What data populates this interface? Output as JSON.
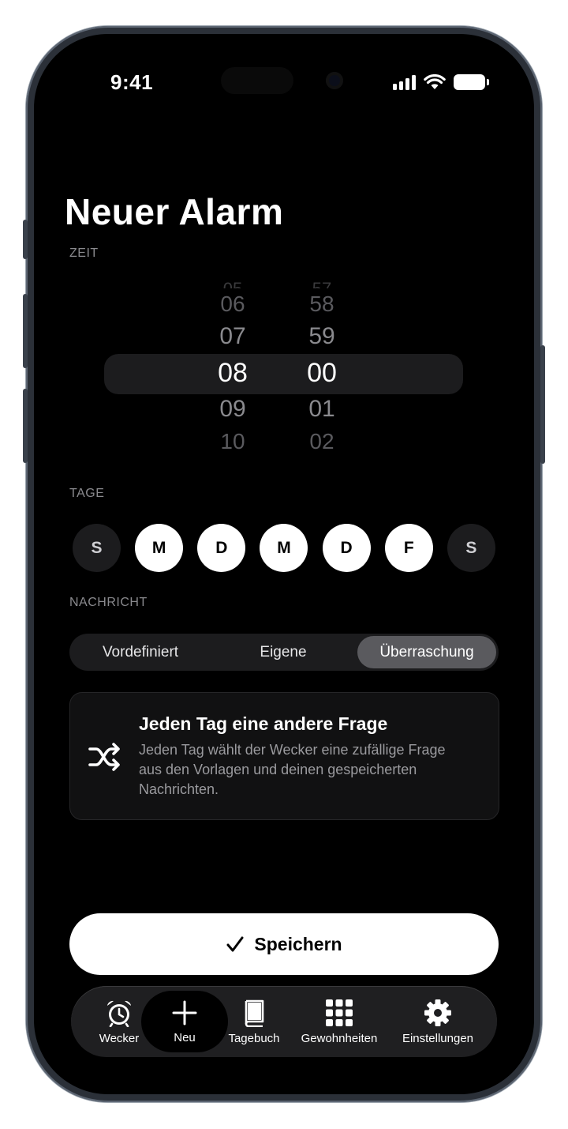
{
  "status": {
    "time": "9:41"
  },
  "page": {
    "title": "Neuer Alarm"
  },
  "time_section": {
    "label": "ZEIT",
    "hours": [
      "06",
      "07",
      "08",
      "09",
      "10"
    ],
    "minutes": [
      "58",
      "59",
      "00",
      "01",
      "02"
    ],
    "selected_hour": "08",
    "selected_minute": "00"
  },
  "days_section": {
    "label": "TAGE",
    "days": [
      {
        "letter": "S",
        "active": false
      },
      {
        "letter": "M",
        "active": true
      },
      {
        "letter": "D",
        "active": true
      },
      {
        "letter": "M",
        "active": true
      },
      {
        "letter": "D",
        "active": true
      },
      {
        "letter": "F",
        "active": true
      },
      {
        "letter": "S",
        "active": false
      }
    ]
  },
  "message_section": {
    "label": "NACHRICHT",
    "options": [
      "Vordefiniert",
      "Eigene",
      "Überraschung"
    ],
    "selected": "Überraschung"
  },
  "info_card": {
    "icon": "shuffle-icon",
    "title": "Jeden Tag eine andere Frage",
    "description": "Jeden Tag wählt der Wecker eine zufällige Frage aus den Vorlagen und deinen gespeicherten Nachrichten."
  },
  "save_button": {
    "label": "Speichern",
    "icon": "checkmark-icon"
  },
  "tabbar": {
    "items": [
      {
        "label": "Wecker",
        "icon": "alarm-clock-icon"
      },
      {
        "label": "Neu",
        "icon": "plus-icon",
        "active": true
      },
      {
        "label": "Tagebuch",
        "icon": "book-icon"
      },
      {
        "label": "Gewohnheiten",
        "icon": "grid-icon"
      },
      {
        "label": "Einstellungen",
        "icon": "gear-icon"
      }
    ]
  }
}
